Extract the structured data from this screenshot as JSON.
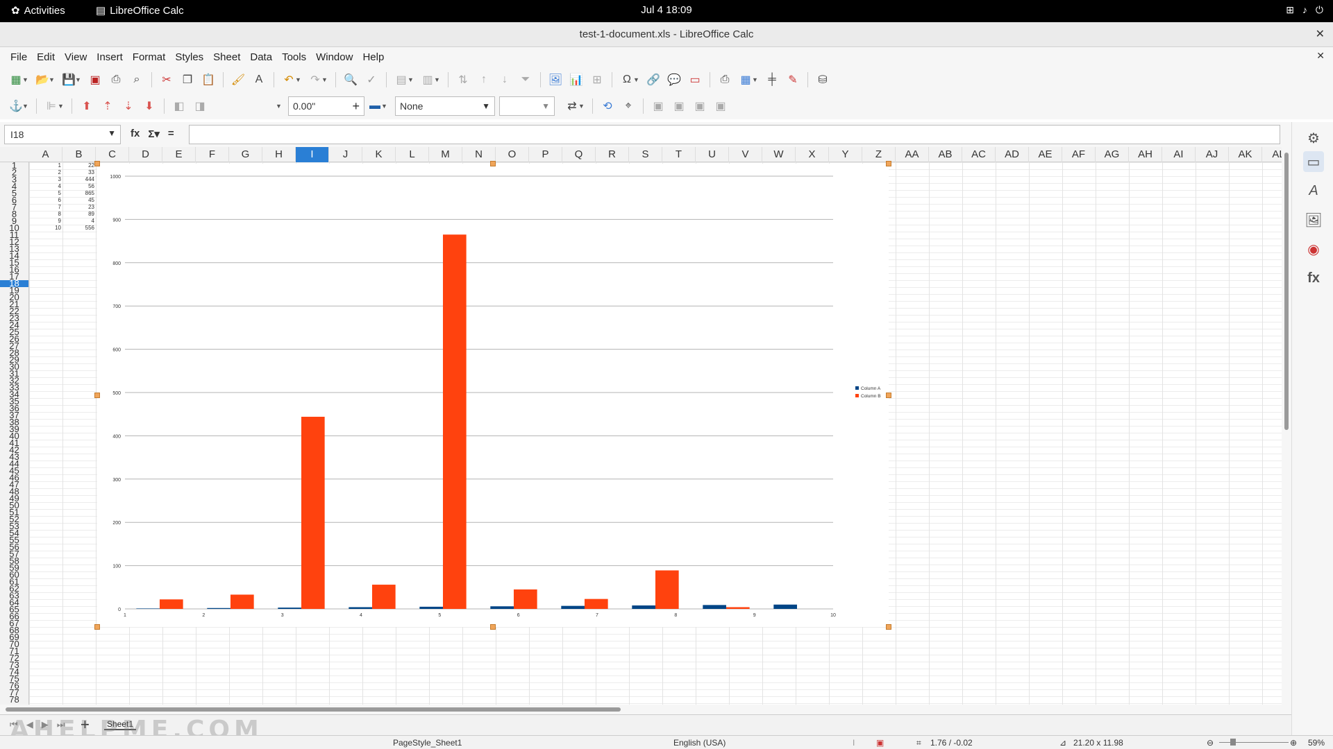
{
  "system": {
    "activities": "Activities",
    "app_name": "LibreOffice Calc",
    "clock": "Jul 4  18:09"
  },
  "window": {
    "title": "test-1-document.xls - LibreOffice Calc"
  },
  "menu": [
    "File",
    "Edit",
    "View",
    "Insert",
    "Format",
    "Styles",
    "Sheet",
    "Data",
    "Tools",
    "Window",
    "Help"
  ],
  "toolbar2": {
    "width_value": "0.00\"",
    "line_style": "None",
    "line_width": ""
  },
  "formula_bar": {
    "cell_ref": "I18",
    "content": ""
  },
  "columns": [
    "A",
    "B",
    "C",
    "D",
    "E",
    "F",
    "G",
    "H",
    "I",
    "J",
    "K",
    "L",
    "M",
    "N",
    "O",
    "P",
    "Q",
    "R",
    "S",
    "T",
    "U",
    "V",
    "W",
    "X",
    "Y",
    "Z",
    "AA",
    "AB",
    "AC",
    "AD",
    "AE",
    "AF",
    "AG",
    "AH",
    "AI",
    "AJ",
    "AK",
    "AL"
  ],
  "selected_column": "I",
  "selected_row": 18,
  "row_count": 78,
  "cells": {
    "colA": [
      1,
      2,
      3,
      4,
      5,
      6,
      7,
      8,
      9,
      10
    ],
    "colB": [
      22,
      33,
      444,
      56,
      865,
      45,
      23,
      89,
      4,
      556
    ]
  },
  "chart_data": {
    "type": "bar",
    "categories": [
      "1",
      "2",
      "3",
      "4",
      "5",
      "6",
      "7",
      "8",
      "9",
      "10"
    ],
    "series": [
      {
        "name": "Column A",
        "values": [
          1,
          2,
          3,
          4,
          5,
          6,
          7,
          8,
          9,
          10
        ],
        "color": "#004586"
      },
      {
        "name": "Column B",
        "values": [
          22,
          33,
          444,
          56,
          865,
          45,
          23,
          89,
          4,
          0
        ],
        "color": "#ff420e"
      }
    ],
    "ylim": [
      0,
      1000
    ],
    "yticks": [
      0,
      100,
      200,
      300,
      400,
      500,
      600,
      700,
      800,
      900,
      1000
    ],
    "grid": true,
    "legend": "right"
  },
  "sheet_tabs": [
    "Sheet1"
  ],
  "watermark": "AHELPME.COM",
  "status": {
    "page_style": "PageStyle_Sheet1",
    "language": "English (USA)",
    "position": "1.76 / -0.02",
    "size": "21.20 x 11.98",
    "zoom": "59%"
  }
}
